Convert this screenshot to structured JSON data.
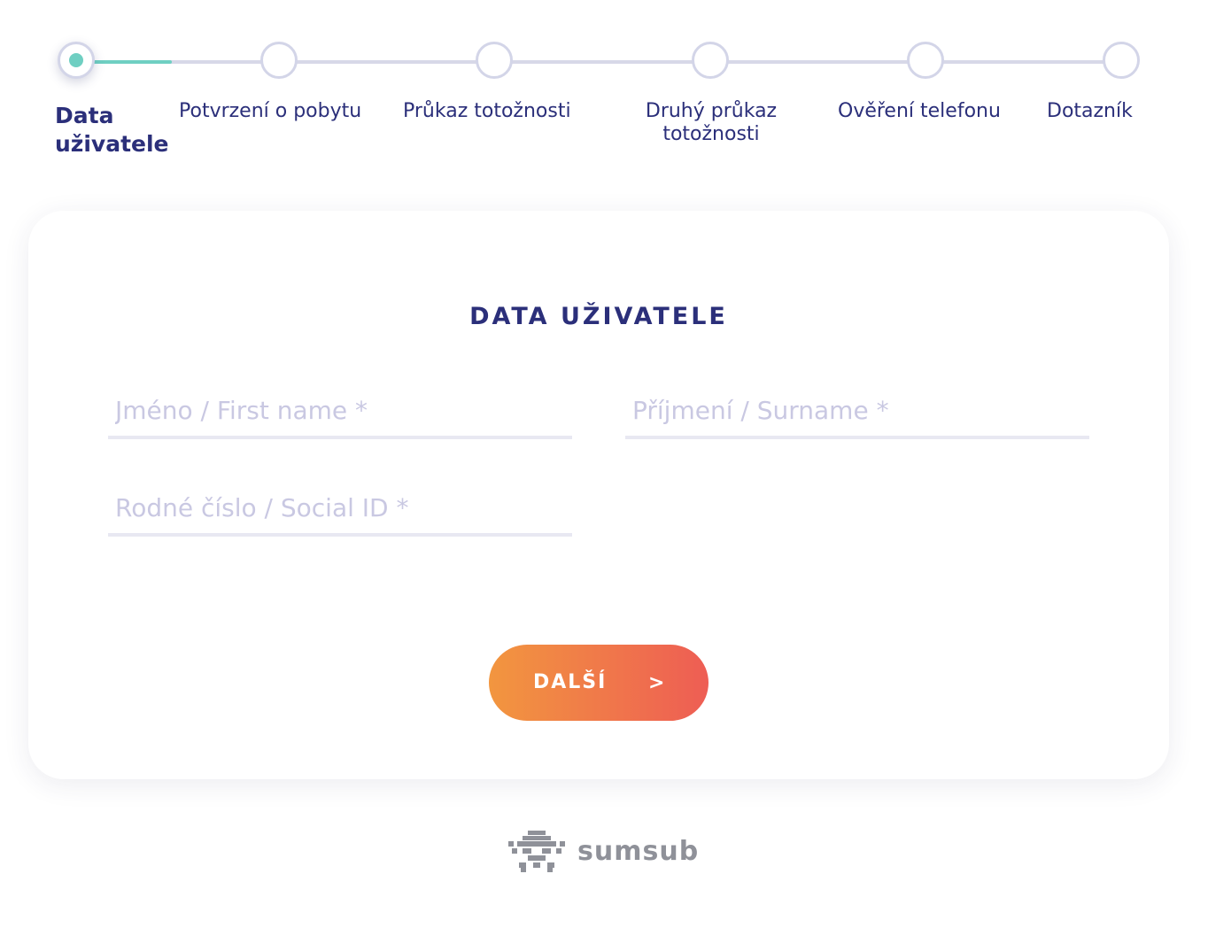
{
  "stepper": {
    "steps": [
      {
        "label": "Data uživatele",
        "state": "active"
      },
      {
        "label": "Potvrzení o pobytu",
        "state": "pending"
      },
      {
        "label": "Průkaz totožnosti",
        "state": "pending"
      },
      {
        "label": "Druhý průkaz totožnosti",
        "label_line1": "Druhý průkaz",
        "label_line2": "totožnosti",
        "state": "pending"
      },
      {
        "label": "Ověření telefonu",
        "state": "pending"
      },
      {
        "label": "Dotazník",
        "state": "pending"
      }
    ],
    "progress_fraction": 0.09
  },
  "form": {
    "title": "DATA UŽIVATELE",
    "fields": {
      "first_name": {
        "placeholder": "Jméno / First name *",
        "value": ""
      },
      "surname": {
        "placeholder": "Příjmení / Surname *",
        "value": ""
      },
      "social_id": {
        "placeholder": "Rodné číslo / Social ID *",
        "value": ""
      }
    },
    "next_button": {
      "label": "DALŠÍ",
      "arrow": ">"
    }
  },
  "footer": {
    "logo_text": "sumsub",
    "logo_icon": "sumsub-robot-icon"
  },
  "colors": {
    "primary_text": "#2b2f7a",
    "accent_teal": "#6fcfc2",
    "track": "#d7d8e8",
    "button_gradient_start": "#f2963f",
    "button_gradient_end": "#ee5d54",
    "placeholder": "#c9c8e2"
  }
}
